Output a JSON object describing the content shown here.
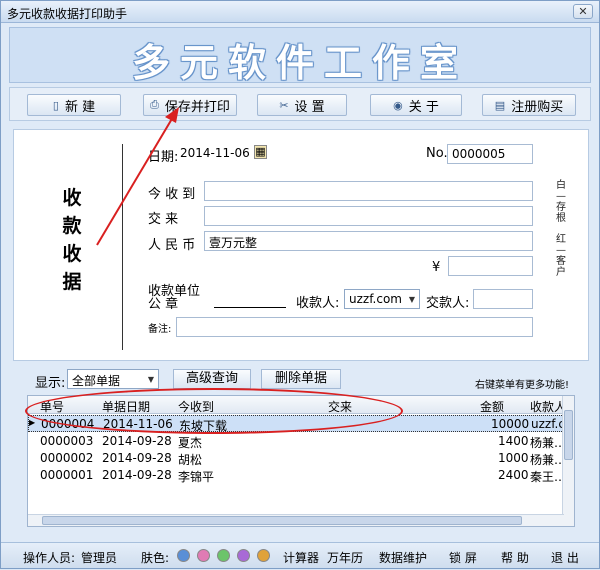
{
  "window": {
    "title": "多元收款收据打印助手",
    "close_glyph": "✕"
  },
  "banner": {
    "title": "多元软件工作室"
  },
  "toolbar": {
    "new_label": "新 建",
    "save_print_label": "保存并打印",
    "settings_label": "设 置",
    "about_label": "关 于",
    "register_label": "注册购买"
  },
  "form": {
    "vertical_title": [
      "收",
      "款",
      "收",
      "据"
    ],
    "date_label": "日期:",
    "date_value": "2014-11-06",
    "no_label": "No.",
    "no_value": "0000005",
    "receive_from_label": "今 收 到",
    "receive_from_value": "",
    "pay_for_label": "交    来",
    "pay_for_value": "",
    "rmb_label": "人 民 币",
    "rmb_value": "壹万元整",
    "yen_label": "¥",
    "yen_value": "",
    "payee_unit_label": "收款单位",
    "seal_label": "公    章",
    "payee_label": "收款人:",
    "payee_value": "uzzf.com",
    "payer_label": "交款人:",
    "payer_value": "",
    "remark_label": "备注:",
    "remark_value": "",
    "side_white": "白—存根",
    "side_red": "红—客户"
  },
  "filter": {
    "show_label": "显示:",
    "show_value": "全部单据",
    "advanced_search_label": "高级查询",
    "delete_label": "删除单据",
    "hint": "右键菜单有更多功能!"
  },
  "grid": {
    "columns": [
      "单号",
      "单据日期",
      "今收到",
      "交来",
      "金额",
      "收款人"
    ],
    "rows": [
      {
        "no": "0000004",
        "date": "2014-11-06",
        "from": "东坡下载",
        "for": "",
        "amount": "10000",
        "payee": "uzzf.c"
      },
      {
        "no": "0000003",
        "date": "2014-09-28",
        "from": "夏杰",
        "for": "",
        "amount": "1400",
        "payee": "杨兼…"
      },
      {
        "no": "0000002",
        "date": "2014-09-28",
        "from": "胡松",
        "for": "",
        "amount": "1000",
        "payee": "杨兼…"
      },
      {
        "no": "0000001",
        "date": "2014-09-28",
        "from": "李锦平",
        "for": "",
        "amount": "2400",
        "payee": "秦王…"
      }
    ]
  },
  "statusbar": {
    "operator_label": "操作人员:",
    "operator_value": "管理员",
    "skin_label": "肤色:",
    "skin_colors": [
      "#5a8fd6",
      "#e07bb4",
      "#6cc46a",
      "#a86ad6",
      "#e0a23a"
    ],
    "calculator": "计算器",
    "calendar": "万年历",
    "maintenance": "数据维护",
    "lock": "锁 屏",
    "help": "帮 助",
    "exit": "退 出"
  }
}
